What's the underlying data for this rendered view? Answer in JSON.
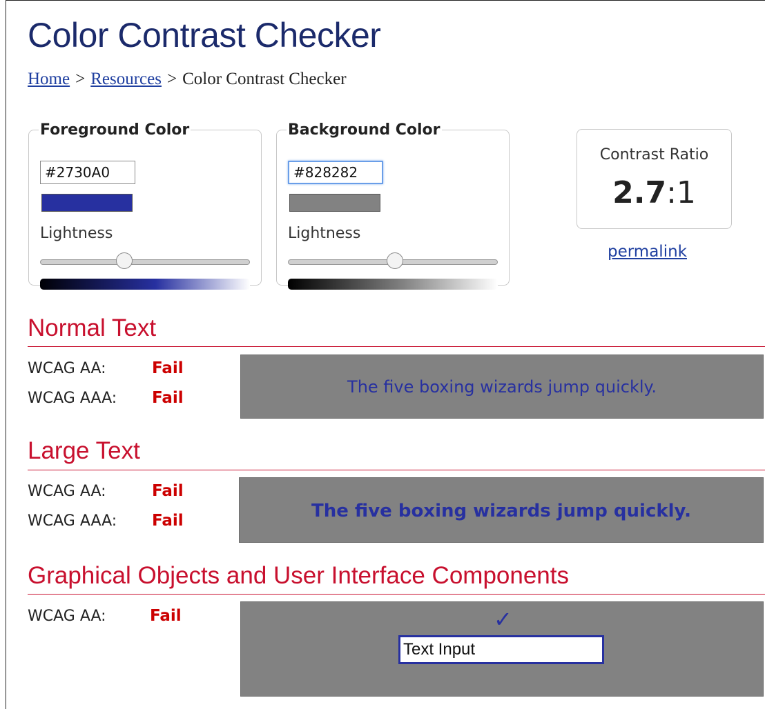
{
  "title": "Color Contrast Checker",
  "breadcrumb": {
    "home": "Home",
    "resources": "Resources",
    "current": "Color Contrast Checker",
    "separator": ">"
  },
  "foreground": {
    "legend": "Foreground Color",
    "hex": "#2730A0",
    "swatch_color": "#2730a0",
    "lightness_label": "Lightness",
    "lightness_fraction": 0.4
  },
  "background": {
    "legend": "Background Color",
    "hex": "#828282",
    "swatch_color": "#828282",
    "lightness_label": "Lightness",
    "lightness_fraction": 0.51
  },
  "contrast": {
    "label": "Contrast Ratio",
    "value": "2.7",
    "suffix": ":1",
    "permalink": "permalink"
  },
  "normal_text": {
    "heading": "Normal Text",
    "aa_label": "WCAG AA:",
    "aa_result": "Fail",
    "aaa_label": "WCAG AAA:",
    "aaa_result": "Fail",
    "sample": "The five boxing wizards jump quickly."
  },
  "large_text": {
    "heading": "Large Text",
    "aa_label": "WCAG AA:",
    "aa_result": "Fail",
    "aaa_label": "WCAG AAA:",
    "aaa_result": "Fail",
    "sample": "The five boxing wizards jump quickly."
  },
  "graphical": {
    "heading": "Graphical Objects and User Interface Components",
    "aa_label": "WCAG AA:",
    "aa_result": "Fail",
    "check_icon": "check-icon",
    "input_value": "Text Input"
  },
  "colors": {
    "title": "#1b2a6b",
    "link": "#1f3fa0",
    "section_heading": "#c8102e",
    "fail": "#cc0000"
  }
}
